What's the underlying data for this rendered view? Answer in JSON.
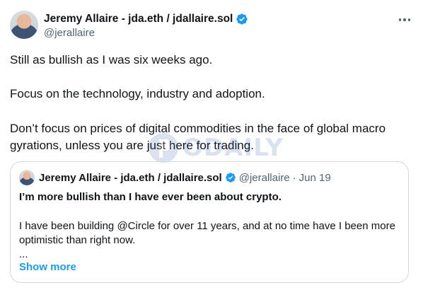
{
  "tweet": {
    "author": {
      "display_name": "Jeremy Allaire - jda.eth / jdallaire.sol",
      "handle": "@jerallaire",
      "verified": true
    },
    "paragraphs": [
      "Still as bullish as I was six weeks ago.",
      "Focus on the technology, industry and adoption.",
      "Don’t focus on prices of digital commodities in the face of global macro gyrations, unless you are just here for trading."
    ],
    "more_icon": "ellipsis-icon"
  },
  "quote": {
    "author": {
      "display_name": "Jeremy Allaire - jda.eth / jdallaire.sol",
      "handle": "@jerallaire",
      "separator": "·",
      "date": "Jun 19"
    },
    "title": "I’m more bullish than I have ever been about crypto.",
    "body": "I have been building @Circle for over 11 years, and at no time have I been more optimistic than right now.",
    "ellipsis": "...",
    "show_more": "Show more"
  },
  "watermark": {
    "text": "ODAILY"
  },
  "colors": {
    "text": "#0f1419",
    "secondary": "#536471",
    "accent": "#1d9bf0",
    "border": "#cfd9de"
  }
}
